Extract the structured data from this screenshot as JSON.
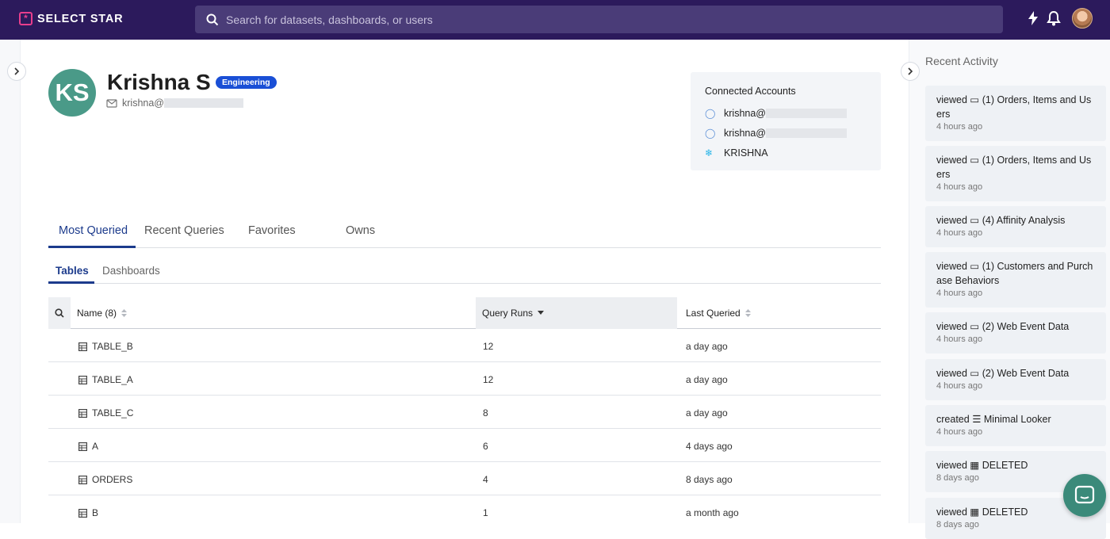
{
  "app": {
    "name": "SELECT STAR",
    "logo_mark": "*"
  },
  "search": {
    "placeholder": "Search for datasets, dashboards, or users"
  },
  "topbar_icons": [
    "lightning-icon",
    "bell-icon",
    "user-avatar"
  ],
  "profile": {
    "initials": "KS",
    "name": "Krishna S",
    "team": "Engineering",
    "email_visible": "krishna@"
  },
  "connected_accounts": {
    "title": "Connected Accounts",
    "items": [
      {
        "icon": "looker-icon",
        "label": "krishna@"
      },
      {
        "icon": "looker-icon",
        "label": "krishna@"
      },
      {
        "icon": "snowflake-icon",
        "label": "KRISHNA"
      }
    ]
  },
  "tabs": [
    "Most Queried",
    "Recent Queries",
    "Favorites",
    "Owns"
  ],
  "subtabs": [
    "Tables",
    "Dashboards"
  ],
  "table": {
    "headers": {
      "name": "Name (8)",
      "runs": "Query Runs",
      "last": "Last Queried"
    },
    "rows": [
      {
        "name": "TABLE_B",
        "runs": "12",
        "last": "a day ago"
      },
      {
        "name": "TABLE_A",
        "runs": "12",
        "last": "a day ago"
      },
      {
        "name": "TABLE_C",
        "runs": "8",
        "last": "a day ago"
      },
      {
        "name": "A",
        "runs": "6",
        "last": "4 days ago"
      },
      {
        "name": "ORDERS",
        "runs": "4",
        "last": "8 days ago"
      },
      {
        "name": "B",
        "runs": "1",
        "last": "a month ago"
      }
    ]
  },
  "recent_activity": {
    "title": "Recent Activity",
    "items": [
      {
        "action": "viewed",
        "icon": "dashboard-icon",
        "text": "(1) Orders, Items and Users",
        "time": "4 hours ago"
      },
      {
        "action": "viewed",
        "icon": "dashboard-icon",
        "text": "(1) Orders, Items and Users",
        "time": "4 hours ago"
      },
      {
        "action": "viewed",
        "icon": "dashboard-icon",
        "text": "(4) Affinity Analysis",
        "time": "4 hours ago"
      },
      {
        "action": "viewed",
        "icon": "dashboard-icon",
        "text": "(1) Customers and Purchase Behaviors",
        "time": "4 hours ago"
      },
      {
        "action": "viewed",
        "icon": "dashboard-icon",
        "text": "(2) Web Event Data",
        "time": "4 hours ago"
      },
      {
        "action": "viewed",
        "icon": "dashboard-icon",
        "text": "(2) Web Event Data",
        "time": "4 hours ago"
      },
      {
        "action": "created",
        "icon": "database-icon",
        "text": "Minimal Looker",
        "time": "4 hours ago"
      },
      {
        "action": "viewed",
        "icon": "table-icon",
        "text": "DELETED",
        "time": "8 days ago"
      },
      {
        "action": "viewed",
        "icon": "table-icon",
        "text": "DELETED",
        "time": "8 days ago"
      }
    ]
  },
  "colors": {
    "topbar": "#2c1a5c",
    "accent": "#1c3b8c",
    "badge": "#1a4fd6",
    "avatar": "#4a9a88",
    "logo": "#e83e8c"
  }
}
